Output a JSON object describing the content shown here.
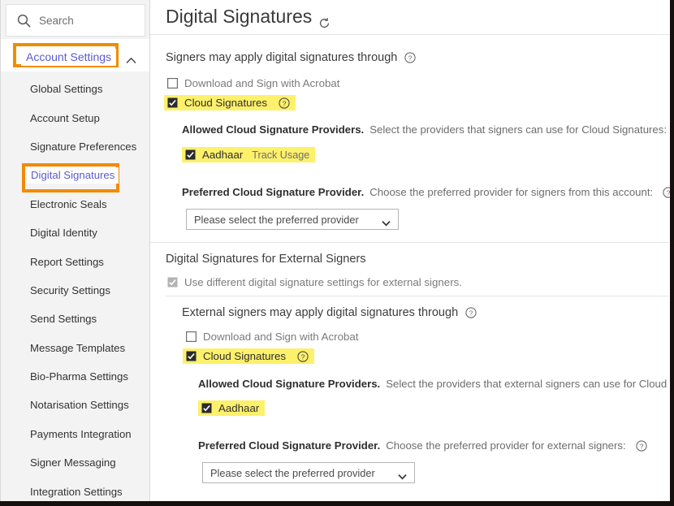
{
  "colors": {
    "highlight_yellow": "#fdf06b",
    "callout_orange": "#f28b00",
    "link_blue": "#5a5ad2",
    "sidebar_bg": "#f3f3f3"
  },
  "sidebar": {
    "search": {
      "placeholder": "Search",
      "icon": "search-icon"
    },
    "group": {
      "label": "Account Settings",
      "chevron": "chevron-up-icon",
      "expanded": true
    },
    "items": [
      {
        "label": "Global Settings",
        "selected": false
      },
      {
        "label": "Account Setup",
        "selected": false
      },
      {
        "label": "Signature Preferences",
        "selected": false
      },
      {
        "label": "Digital Signatures",
        "selected": true
      },
      {
        "label": "Electronic Seals",
        "selected": false
      },
      {
        "label": "Digital Identity",
        "selected": false
      },
      {
        "label": "Report Settings",
        "selected": false
      },
      {
        "label": "Security Settings",
        "selected": false
      },
      {
        "label": "Send Settings",
        "selected": false
      },
      {
        "label": "Message Templates",
        "selected": false
      },
      {
        "label": "Bio-Pharma Settings",
        "selected": false
      },
      {
        "label": "Notarisation Settings",
        "selected": false
      },
      {
        "label": "Payments Integration",
        "selected": false
      },
      {
        "label": "Signer Messaging",
        "selected": false
      },
      {
        "label": "Integration Settings",
        "selected": false
      }
    ]
  },
  "main": {
    "title": "Digital Signatures",
    "refresh_icon": "refresh-icon",
    "section1": {
      "heading": "Signers may apply digital signatures through",
      "help_icon": "help-icon",
      "checkbox_acrobat": {
        "label": "Download and Sign with Acrobat",
        "checked": false,
        "highlighted": false
      },
      "checkbox_cloud": {
        "label": "Cloud Signatures",
        "checked": true,
        "highlighted": true,
        "help_icon": "help-icon"
      },
      "allowed_label": "Allowed Cloud Signature Providers.",
      "allowed_desc": "Select the providers that signers can use for Cloud Signatures:",
      "allowed_help_icon": "help-icon",
      "provider": {
        "label": "Aadhaar",
        "extra": "Track Usage",
        "checked": true,
        "highlighted": true
      },
      "preferred_label": "Preferred Cloud Signature Provider.",
      "preferred_desc": "Choose the preferred provider for signers from this account:",
      "preferred_help_icon": "help-icon",
      "dropdown_value": "Please select the preferred provider",
      "dropdown_icon": "chevron-down-icon"
    },
    "section2": {
      "heading": "Digital Signatures for External Signers",
      "use_different": {
        "label": "Use different digital signature settings for external signers.",
        "checked": true,
        "disabled": true
      },
      "sub_heading": "External signers may apply digital signatures through",
      "sub_help_icon": "help-icon",
      "checkbox_acrobat": {
        "label": "Download and Sign with Acrobat",
        "checked": false,
        "highlighted": false
      },
      "checkbox_cloud": {
        "label": "Cloud Signatures",
        "checked": true,
        "highlighted": true,
        "help_icon": "help-icon"
      },
      "allowed_label": "Allowed Cloud Signature Providers.",
      "allowed_desc": "Select the providers that external signers can use for Cloud Signatures:",
      "provider": {
        "label": "Aadhaar",
        "checked": true,
        "highlighted": true
      },
      "preferred_label": "Preferred Cloud Signature Provider.",
      "preferred_desc": "Choose the preferred provider for external signers:",
      "preferred_help_icon": "help-icon",
      "dropdown_value": "Please select the preferred provider",
      "dropdown_icon": "chevron-down-icon"
    }
  }
}
